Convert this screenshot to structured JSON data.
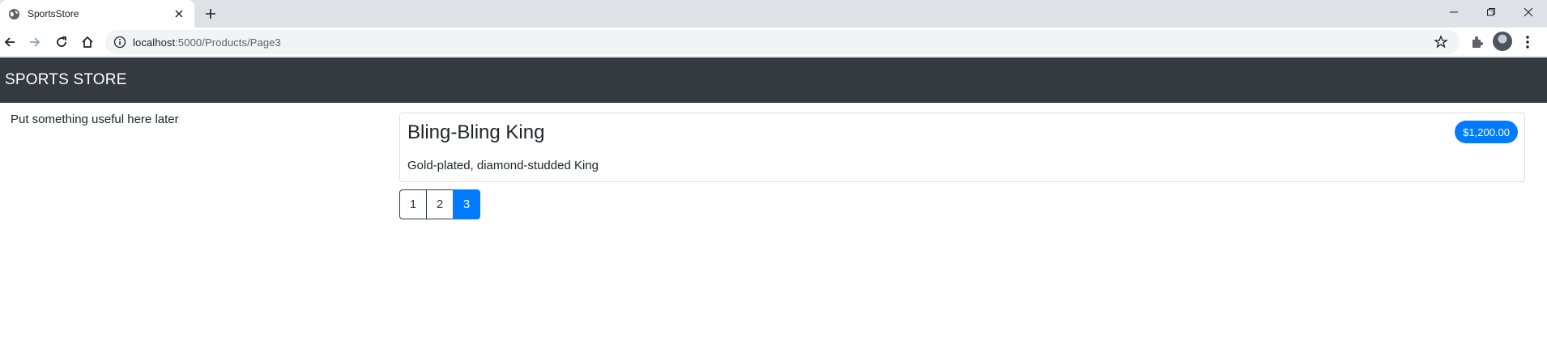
{
  "browser": {
    "tab": {
      "title": "SportsStore",
      "favicon": "globe-icon",
      "close_icon": "close-icon"
    },
    "new_tab_icon": "plus-icon",
    "window_controls": [
      "minimize-icon",
      "restore-icon",
      "close-window-icon"
    ],
    "nav": [
      "back-icon",
      "forward-icon",
      "reload-icon",
      "home-icon"
    ],
    "address": {
      "host": "localhost",
      "rest": ":5000/Products/Page3"
    }
  },
  "site": {
    "brand": "SPORTS STORE",
    "sidebar_text": "Put something useful here later",
    "product": {
      "name": "Bling-Bling King",
      "price": "$1,200.00",
      "description": "Gold-plated, diamond-studded King"
    },
    "pagination": {
      "pages": [
        "1",
        "2",
        "3"
      ],
      "current": "3"
    }
  },
  "colors": {
    "navbar": "#343a40",
    "accent": "#007bff",
    "tabstrip": "#dee1e6"
  }
}
